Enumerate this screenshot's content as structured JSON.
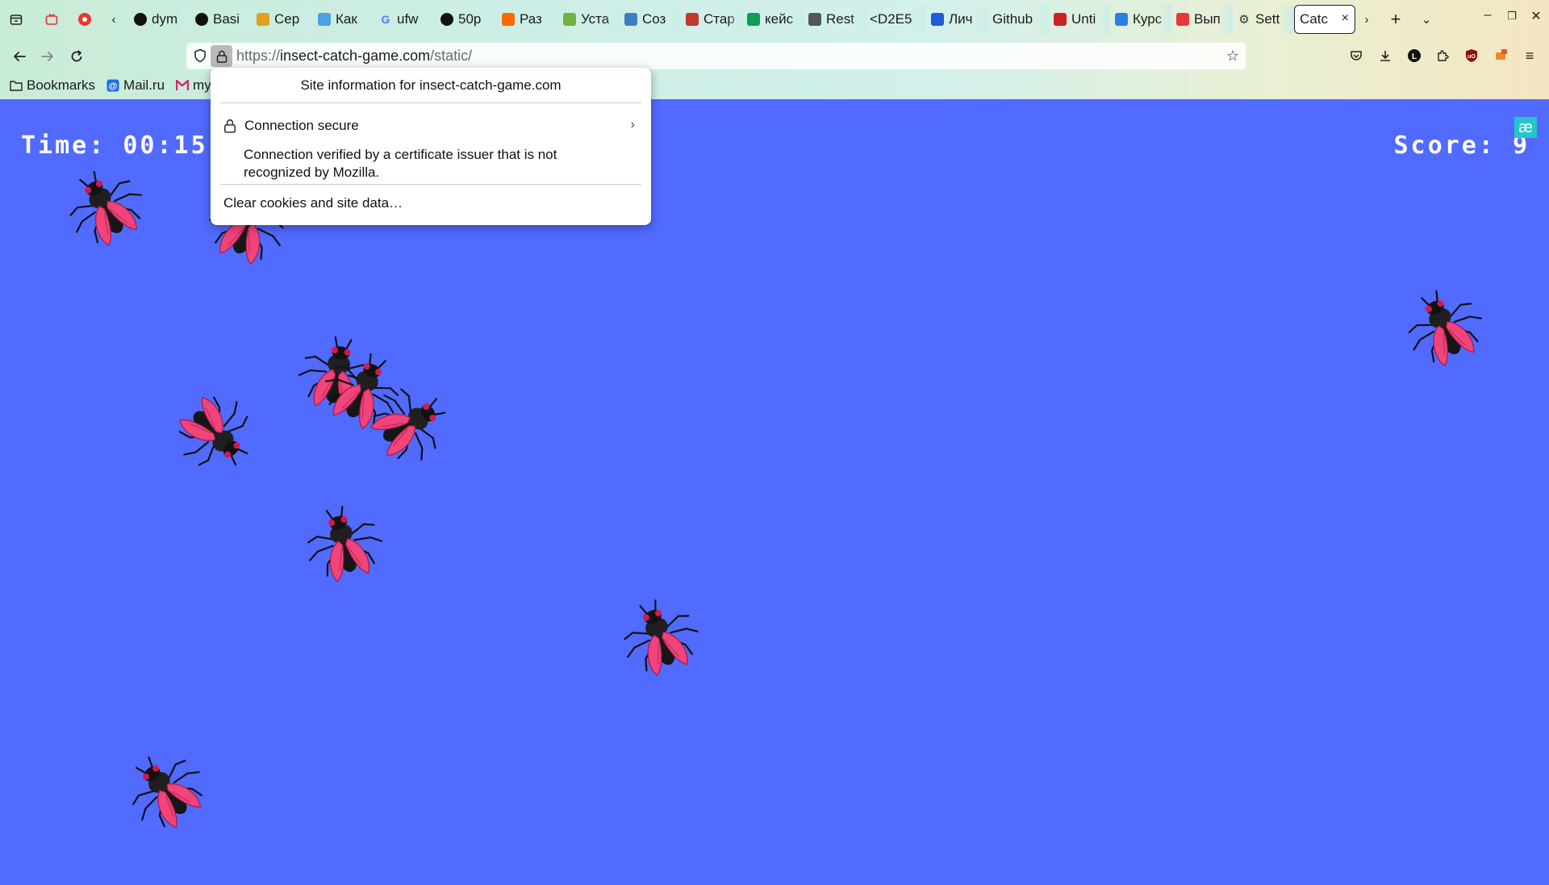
{
  "browser": {
    "tabs": [
      {
        "label": "dym",
        "icon": "github-icon",
        "color": "#111"
      },
      {
        "label": "Basi",
        "icon": "github-icon",
        "color": "#111"
      },
      {
        "label": "Cep",
        "icon": "favicon-icon",
        "color": "#e0a020"
      },
      {
        "label": "Как",
        "icon": "favicon-icon",
        "color": "#4aa3df"
      },
      {
        "label": "ufw",
        "icon": "google-icon",
        "color": "#4285f4"
      },
      {
        "label": "50p",
        "icon": "github-icon",
        "color": "#111"
      },
      {
        "label": "Раз",
        "icon": "favicon-icon",
        "color": "#ff6a00"
      },
      {
        "label": "Уста",
        "icon": "favicon-icon",
        "color": "#6db33f"
      },
      {
        "label": "Соз",
        "icon": "favicon-icon",
        "color": "#3d7fc1"
      },
      {
        "label": "Стар",
        "icon": "favicon-icon",
        "color": "#c0392b"
      },
      {
        "label": "кейс",
        "icon": "drive-icon",
        "color": "#0f9d58"
      },
      {
        "label": "Rest",
        "icon": "favicon-icon",
        "color": "#555"
      },
      {
        "label": "<D2E5",
        "icon": "",
        "color": ""
      },
      {
        "label": "Лич",
        "icon": "favicon-icon",
        "color": "#1f5bd8"
      },
      {
        "label": "Github",
        "icon": "",
        "color": ""
      },
      {
        "label": "Unti",
        "icon": "favicon-icon",
        "color": "#c22"
      },
      {
        "label": "Курс",
        "icon": "favicon-icon",
        "color": "#2a7de1"
      },
      {
        "label": "Вып",
        "icon": "favicon-icon",
        "color": "#e53935"
      },
      {
        "label": "Sett",
        "icon": "gear-icon",
        "color": "#333"
      }
    ],
    "active_tab": {
      "label": "Catc",
      "close": "×"
    },
    "url": {
      "scheme": "https://",
      "domain": "insect-catch-game.com",
      "path": "/static/"
    },
    "bookmarks": [
      {
        "label": "Bookmarks",
        "icon": "folder-icon"
      },
      {
        "label": "Mail.ru",
        "icon": "mail-icon"
      },
      {
        "label": "my",
        "icon": "favicon-icon"
      }
    ]
  },
  "site_panel": {
    "title": "Site information for insect-catch-game.com",
    "connection": "Connection secure",
    "description": "Connection verified by a certificate issuer that is not recognized by Mozilla.",
    "clear": "Clear cookies and site data…"
  },
  "game": {
    "time_label": "Time:",
    "time_value": "00:15",
    "score_label": "Score:",
    "score_value": "9",
    "extension_badge": "æ",
    "insect_count": 11
  }
}
